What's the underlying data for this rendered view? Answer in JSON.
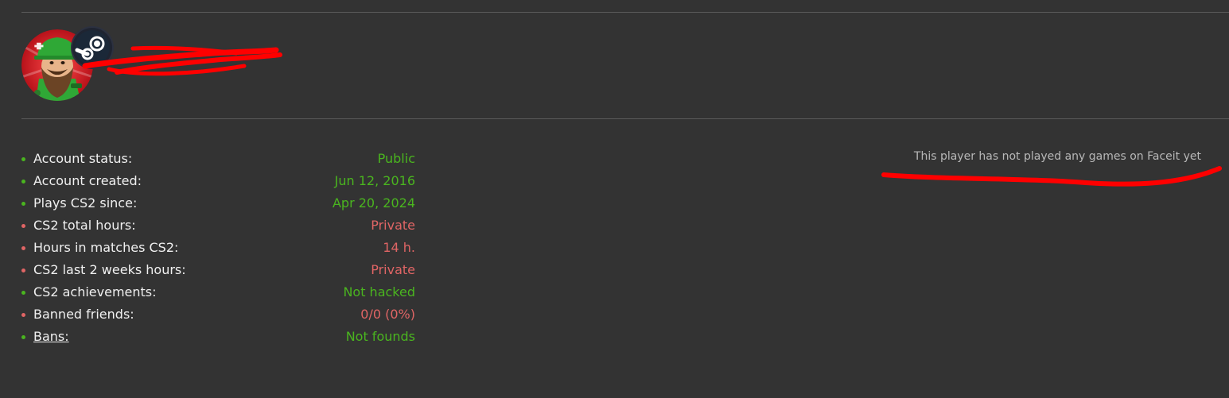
{
  "colors": {
    "background": "#333333",
    "good": "#4ab51f",
    "bad": "#e06565",
    "label": "#f0f0f0",
    "notice": "#b8b8b8",
    "redaction": "#ff0000"
  },
  "profile": {
    "avatar_icon": "bearded-soldier-avatar",
    "badge_icon": "steam-icon"
  },
  "stats": [
    {
      "label": "Account status:",
      "value": "Public",
      "status": "good"
    },
    {
      "label": "Account created:",
      "value": "Jun 12, 2016",
      "status": "good"
    },
    {
      "label": "Plays CS2 since:",
      "value": "Apr 20, 2024",
      "status": "good"
    },
    {
      "label": "CS2 total hours:",
      "value": "Private",
      "status": "bad"
    },
    {
      "label": "Hours in matches CS2:",
      "value": "14 h.",
      "status": "bad"
    },
    {
      "label": "CS2 last 2 weeks hours:",
      "value": "Private",
      "status": "bad"
    },
    {
      "label": "CS2 achievements:",
      "value": "Not hacked",
      "status": "good"
    },
    {
      "label": "Banned friends:",
      "value": "0/0 (0%)",
      "status": "bad"
    },
    {
      "label": "Bans:",
      "value": "Not founds",
      "status": "good"
    }
  ],
  "faceit": {
    "notice": "This player has not played any games on Faceit yet"
  }
}
